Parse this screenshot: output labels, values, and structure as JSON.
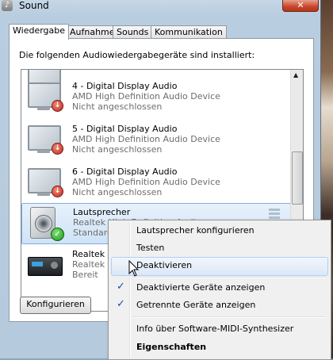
{
  "window": {
    "title": "Sound",
    "close_glyph": "✕"
  },
  "tabs": [
    {
      "label": "Wiedergabe",
      "active": true
    },
    {
      "label": "Aufnahme",
      "active": false
    },
    {
      "label": "Sounds",
      "active": false
    },
    {
      "label": "Kommunikation",
      "active": false
    }
  ],
  "caption": "Die folgenden Audiowiedergabegeräte sind installiert:",
  "devices": [
    {
      "name": "4 - Digital Display Audio",
      "description": "AMD High Definition Audio Device",
      "status": "Nicht angeschlossen",
      "icon": "monitor-icon",
      "badge": "disconnected"
    },
    {
      "name": "5 - Digital Display Audio",
      "description": "AMD High Definition Audio Device",
      "status": "Nicht angeschlossen",
      "icon": "monitor-icon",
      "badge": "disconnected"
    },
    {
      "name": "6 - Digital Display Audio",
      "description": "AMD High Definition Audio Device",
      "status": "Nicht angeschlossen",
      "icon": "monitor-icon",
      "badge": "disconnected"
    },
    {
      "name": "Lautsprecher",
      "description": "Realtek High Definition Audio",
      "status": "Standard",
      "icon": "speaker-icon",
      "badge": "default-checkmark",
      "selected": true
    },
    {
      "name": "Realtek D",
      "description": "Realtek H",
      "status": "Bereit",
      "icon": "receiver-icon",
      "badge": "none"
    }
  ],
  "buttons": {
    "configure": "Konfigurieren"
  },
  "context_menu": {
    "items": [
      {
        "label": "Lautsprecher konfigurieren",
        "checked": false,
        "bold": false
      },
      {
        "label": "Testen",
        "checked": false,
        "bold": false
      },
      {
        "label": "Deaktivieren",
        "checked": false,
        "bold": false,
        "hover": true
      },
      {
        "label": "Deaktivierte Geräte anzeigen",
        "checked": true,
        "bold": false
      },
      {
        "label": "Getrennte Geräte anzeigen",
        "checked": true,
        "bold": false
      },
      {
        "label": "Info über Software-MIDI-Synthesizer",
        "checked": false,
        "bold": false
      },
      {
        "label": "Eigenschaften",
        "checked": false,
        "bold": true
      }
    ],
    "check_glyph": "✓"
  },
  "colors": {
    "selection_bg": "#cfe3f7",
    "menu_hover_border": "#aecff7",
    "check_color": "#1a4ca8",
    "disconnected_badge": "#c0281a",
    "default_badge": "#1f9a1a"
  }
}
